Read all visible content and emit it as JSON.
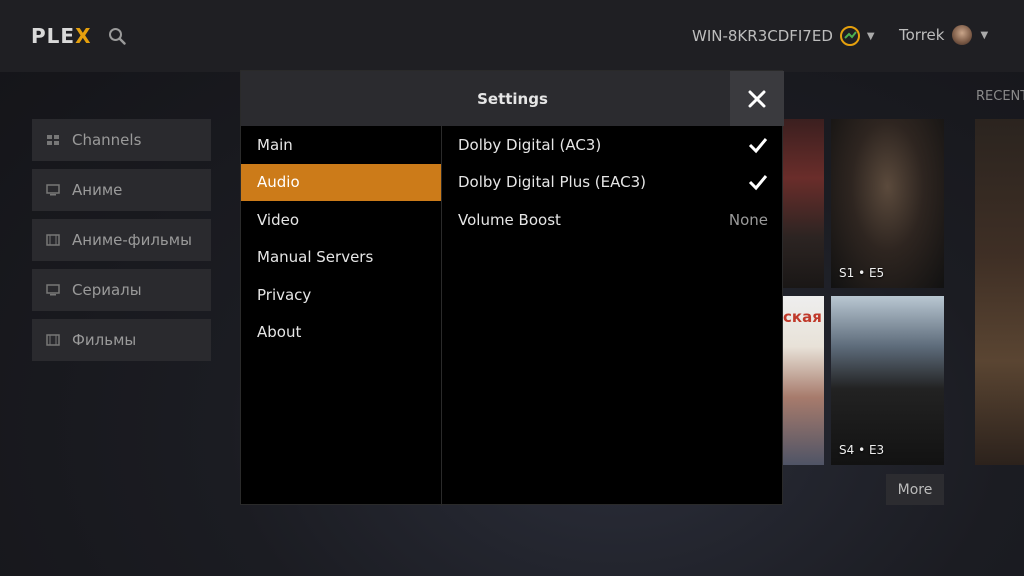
{
  "app": {
    "logo_text_main": "PLE",
    "logo_text_accent": "X",
    "brand_color": "#e5a00d"
  },
  "header": {
    "server_name": "WIN-8KR3CDFI7ED",
    "user_name": "Torrek"
  },
  "sidebar": {
    "items": [
      {
        "label": "Channels",
        "icon": "grid-icon"
      },
      {
        "label": "Аниме",
        "icon": "monitor-icon"
      },
      {
        "label": "Аниме-фильмы",
        "icon": "film-icon"
      },
      {
        "label": "Сериалы",
        "icon": "monitor-icon"
      },
      {
        "label": "Фильмы",
        "icon": "film-icon"
      }
    ]
  },
  "background": {
    "recent_label": "RECENT",
    "posters": [
      {
        "episode": ""
      },
      {
        "episode": "S1 • E5"
      },
      {
        "episode": ""
      },
      {
        "episode": "S4 • E3"
      }
    ],
    "partial_title": "ская",
    "more_label": "More"
  },
  "dialog": {
    "title": "Settings",
    "menu": [
      {
        "label": "Main",
        "active": false
      },
      {
        "label": "Audio",
        "active": true
      },
      {
        "label": "Video",
        "active": false
      },
      {
        "label": "Manual Servers",
        "active": false
      },
      {
        "label": "Privacy",
        "active": false
      },
      {
        "label": "About",
        "active": false
      }
    ],
    "options": [
      {
        "label": "Dolby Digital (AC3)",
        "checked": true,
        "value": ""
      },
      {
        "label": "Dolby Digital Plus (EAC3)",
        "checked": true,
        "value": ""
      },
      {
        "label": "Volume Boost",
        "checked": false,
        "value": "None"
      }
    ],
    "accent_color": "#cc7b19"
  }
}
